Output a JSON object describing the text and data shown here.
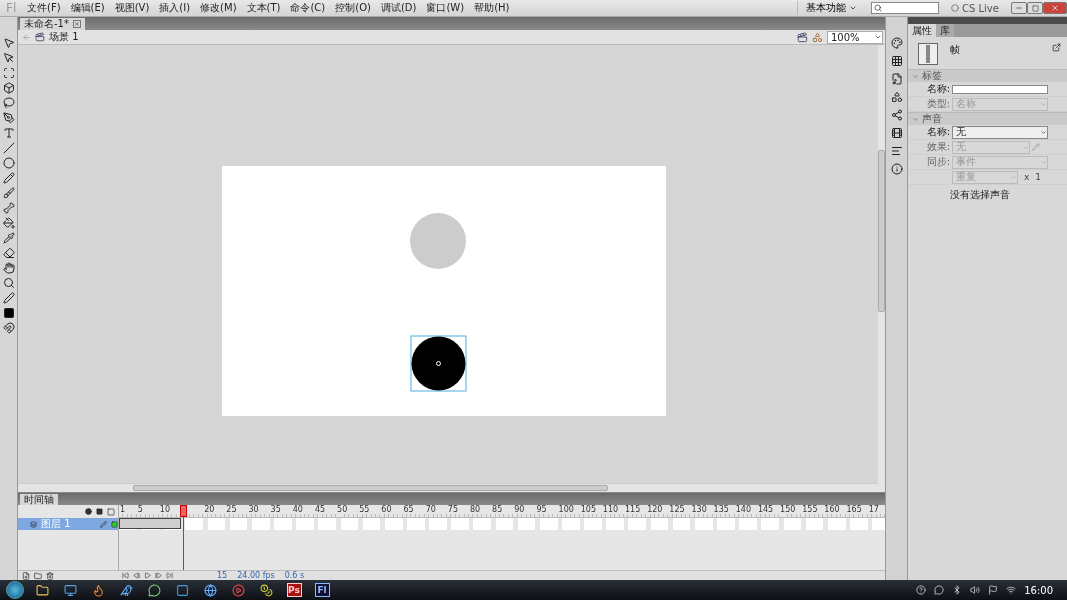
{
  "app": {
    "logo": "Fl"
  },
  "menu": {
    "items": [
      "文件(F)",
      "编辑(E)",
      "视图(V)",
      "插入(I)",
      "修改(M)",
      "文本(T)",
      "命令(C)",
      "控制(O)",
      "调试(D)",
      "窗口(W)",
      "帮助(H)"
    ]
  },
  "workspace": "基本功能",
  "cs_live": "CS Live",
  "document_tab": {
    "title": "未命名-1*"
  },
  "scene": "场景 1",
  "zoom": "100%",
  "timeline": {
    "title": "时间轴",
    "ruler": [
      "1",
      "5",
      "10",
      "20",
      "25",
      "30",
      "35",
      "40",
      "45",
      "50",
      "55",
      "60",
      "65",
      "70",
      "75",
      "80",
      "85",
      "90",
      "95",
      "100",
      "105",
      "110",
      "115",
      "120",
      "125",
      "130",
      "135",
      "140",
      "145",
      "150",
      "155",
      "160",
      "165",
      "17"
    ],
    "layers": [
      {
        "name": "图层 1",
        "selected": true
      }
    ],
    "status": {
      "frame": "15",
      "fps": "24.00 fps",
      "time": "0.6 s"
    }
  },
  "properties": {
    "tabs": [
      {
        "label": "属性",
        "selected": true
      },
      {
        "label": "库",
        "selected": false
      }
    ],
    "heading": "帧",
    "sections": [
      {
        "title": "标签",
        "expanded": true,
        "fields": [
          {
            "kind": "text",
            "label": "名称:",
            "disabled": false
          },
          {
            "kind": "select",
            "label": "类型:",
            "value": "名称",
            "disabled": true
          }
        ]
      },
      {
        "title": "声音",
        "expanded": true,
        "fields": [
          {
            "kind": "select",
            "label": "名称:",
            "value": "无",
            "disabled": false
          },
          {
            "kind": "select",
            "label": "效果:",
            "value": "无",
            "disabled": true,
            "edit": true
          },
          {
            "kind": "select",
            "label": "同步:",
            "value": "事件",
            "disabled": true
          },
          {
            "kind": "repeat",
            "value": "重复",
            "disabled": true,
            "times_sign": "x",
            "count": "1"
          }
        ]
      }
    ],
    "note": "没有选择声音"
  },
  "taskbar": {
    "apps": [
      {
        "kind": "folder"
      },
      {
        "kind": "browser"
      },
      {
        "kind": "fire"
      },
      {
        "kind": "bird"
      },
      {
        "kind": "chat"
      },
      {
        "kind": "window"
      },
      {
        "kind": "globe"
      },
      {
        "kind": "media"
      },
      {
        "kind": "coin"
      },
      {
        "kind": "logo",
        "label": "Ps"
      },
      {
        "kind": "logo",
        "label": "Fl"
      }
    ],
    "clock": "16:00"
  }
}
